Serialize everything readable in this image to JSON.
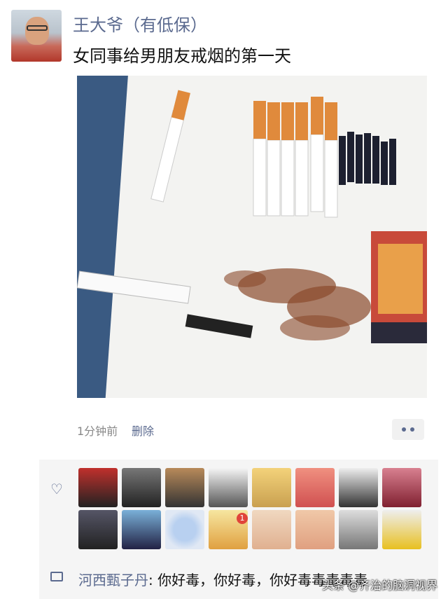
{
  "post": {
    "author": "王大爷（有低保）",
    "text": "女同事给男朋友戒烟的第一天",
    "time": "1分钟前",
    "delete_label": "删除"
  },
  "likes": {
    "icon": "heart-icon",
    "notification_badge": "1",
    "avatar_count": 16
  },
  "comment": {
    "commenter": "河西甄子丹",
    "separator": ":",
    "text": " 你好毒，你好毒，你好毒毒毒毒毒"
  },
  "watermark": "头条 @齐治的脑洞视界"
}
